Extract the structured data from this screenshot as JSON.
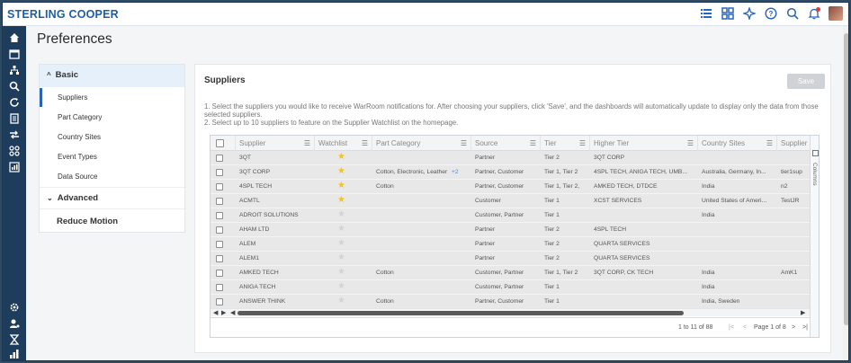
{
  "app": {
    "brand": "STERLING COOPER"
  },
  "page": {
    "title": "Preferences"
  },
  "left_panel": {
    "basic_label": "Basic",
    "basic_items": [
      "Suppliers",
      "Part Category",
      "Country Sites",
      "Event Types",
      "Data Source"
    ],
    "advanced_label": "Advanced",
    "reduce_motion_label": "Reduce Motion"
  },
  "main": {
    "title": "Suppliers",
    "save_label": "Save",
    "instruction_1": "1. Select the suppliers you would like to receive WarRoom notifications for. After choosing your suppliers, click 'Save', and the dashboards will automatically update to display only the data from those selected suppliers.",
    "instruction_2": "2. Select up to 10 suppliers to feature on the Supplier Watchlist on the homepage."
  },
  "grid": {
    "columns": [
      "Supplier",
      "Watchlist",
      "Part Category",
      "Source",
      "Tier",
      "Higher Tier",
      "Country Sites",
      "Supplier"
    ],
    "rows": [
      {
        "supplier": "3QT",
        "watch": true,
        "part": "",
        "more": "",
        "source": "Partner",
        "tier": "Tier 2",
        "higher": "3QT CORP",
        "country": "",
        "extra": ""
      },
      {
        "supplier": "3QT CORP",
        "watch": true,
        "part": "Cotton, Electronic, Leather",
        "more": "+2",
        "source": "Partner, Customer",
        "tier": "Tier 1, Tier 2",
        "higher": "4SPL TECH, ANIGA TECH, UMB...",
        "country": "Australia, Germany, In...",
        "extra": "tier1sup"
      },
      {
        "supplier": "4SPL TECH",
        "watch": true,
        "part": "Cotton",
        "more": "",
        "source": "Partner, Customer",
        "tier": "Tier 1, Tier 2,",
        "higher": "AMKED TECH, DTDCE",
        "country": "India",
        "extra": "n2"
      },
      {
        "supplier": "ACMTL",
        "watch": true,
        "part": "",
        "more": "",
        "source": "Customer",
        "tier": "Tier 1",
        "higher": "XCST SERVICES",
        "country": "United States of Ameri...",
        "extra": "TestJR"
      },
      {
        "supplier": "ADROIT SOLUTIONS",
        "watch": false,
        "part": "",
        "more": "",
        "source": "Customer, Partner",
        "tier": "Tier 1",
        "higher": "",
        "country": "India",
        "extra": ""
      },
      {
        "supplier": "AHAM LTD",
        "watch": false,
        "part": "",
        "more": "",
        "source": "Partner",
        "tier": "Tier 2",
        "higher": "4SPL TECH",
        "country": "",
        "extra": ""
      },
      {
        "supplier": "ALEM",
        "watch": false,
        "part": "",
        "more": "",
        "source": "Partner",
        "tier": "Tier 2",
        "higher": "QUARTA SERVICES",
        "country": "",
        "extra": ""
      },
      {
        "supplier": "ALEM1",
        "watch": false,
        "part": "",
        "more": "",
        "source": "Partner",
        "tier": "Tier 2",
        "higher": "QUARTA SERVICES",
        "country": "",
        "extra": ""
      },
      {
        "supplier": "AMKED TECH",
        "watch": false,
        "part": "Cotton",
        "more": "",
        "source": "Customer, Partner",
        "tier": "Tier 1, Tier 2",
        "higher": "3QT CORP, CK TECH",
        "country": "India",
        "extra": "AmK1"
      },
      {
        "supplier": "ANIGA TECH",
        "watch": false,
        "part": "",
        "more": "",
        "source": "Customer, Partner",
        "tier": "Tier 1",
        "higher": "",
        "country": "India",
        "extra": ""
      },
      {
        "supplier": "ANSWER THINK",
        "watch": false,
        "part": "Cotton",
        "more": "",
        "source": "Partner, Customer",
        "tier": "Tier 1",
        "higher": "",
        "country": "India, Sweden",
        "extra": ""
      }
    ],
    "columns_tab_label": "Columns",
    "pagination": {
      "range": "1 to 11 of 88",
      "page": "Page 1 of 8"
    }
  }
}
